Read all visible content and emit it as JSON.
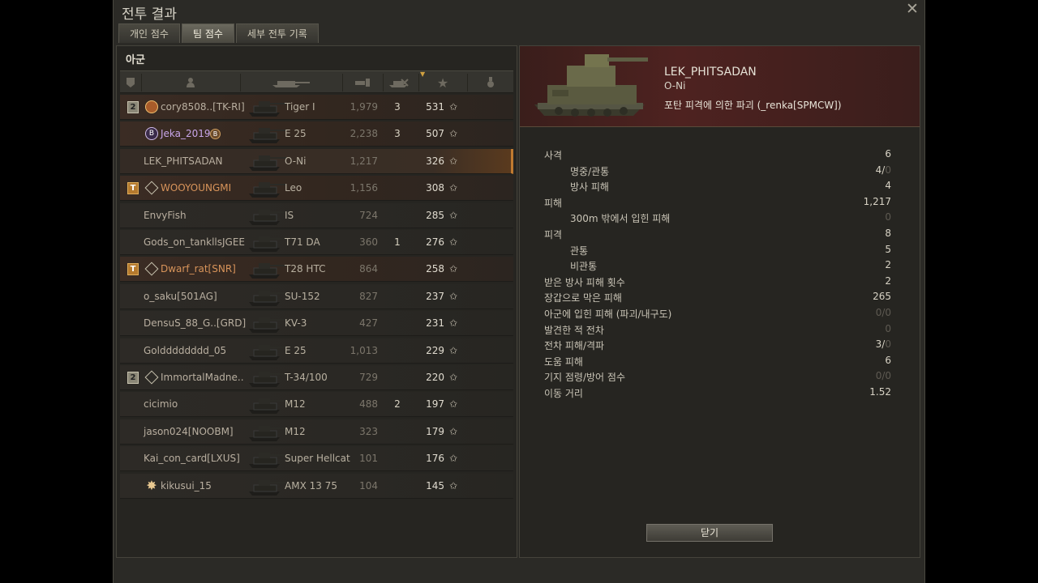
{
  "window": {
    "title": "전투 결과"
  },
  "tabs": [
    {
      "label": "개인 점수",
      "active": false
    },
    {
      "label": "팀 점수",
      "active": true
    },
    {
      "label": "세부 전투 기록",
      "active": false
    }
  ],
  "team": {
    "label": "아군"
  },
  "columns": [
    "platoon-icon",
    "player-icon",
    "tank-icon",
    "damage-icon",
    "kills-icon",
    "xp-star-icon",
    "medal-icon"
  ],
  "players": [
    {
      "badge": "2",
      "icon": "medal",
      "name": "cory8508..[TK-RI]",
      "tank": "Tiger I",
      "damage": "1,979",
      "kills": "3",
      "xp": "531",
      "dead": false
    },
    {
      "badge": "",
      "icon": "b-purple",
      "name": "Jeka_2019",
      "tank": "E 25",
      "damage": "2,238",
      "kills": "3",
      "xp": "507",
      "dead": false
    },
    {
      "badge": "",
      "icon": "",
      "name": "LEK_PHITSADAN",
      "tank": "O-Ni",
      "damage": "1,217",
      "kills": "",
      "xp": "326",
      "dead": true,
      "selected": true
    },
    {
      "badge": "T",
      "icon": "diamond",
      "name": "WOOYOUNGMI",
      "tank": "Leo",
      "damage": "1,156",
      "kills": "",
      "xp": "308",
      "dead": false
    },
    {
      "badge": "",
      "icon": "",
      "name": "EnvyFish",
      "tank": "IS",
      "damage": "724",
      "kills": "",
      "xp": "285",
      "dead": true
    },
    {
      "badge": "",
      "icon": "",
      "name": "Gods_on_tankllsJGEE",
      "tank": "T71 DA",
      "damage": "360",
      "kills": "1",
      "xp": "276",
      "dead": true
    },
    {
      "badge": "T",
      "icon": "diamond",
      "name": "Dwarf_rat[SNR]",
      "tank": "T28 HTC",
      "damage": "864",
      "kills": "",
      "xp": "258",
      "dead": false
    },
    {
      "badge": "",
      "icon": "",
      "name": "o_saku[501AG]",
      "tank": "SU-152",
      "damage": "827",
      "kills": "",
      "xp": "237",
      "dead": true
    },
    {
      "badge": "",
      "icon": "",
      "name": "DensuS_88_G..[GRD]",
      "tank": "KV-3",
      "damage": "427",
      "kills": "",
      "xp": "231",
      "dead": true
    },
    {
      "badge": "",
      "icon": "",
      "name": "Goldddddddd_05",
      "tank": "E 25",
      "damage": "1,013",
      "kills": "",
      "xp": "229",
      "dead": true
    },
    {
      "badge": "2",
      "icon": "diamond",
      "name": "ImmortalMadne..",
      "tank": "T-34/100",
      "damage": "729",
      "kills": "",
      "xp": "220",
      "dead": true
    },
    {
      "badge": "",
      "icon": "",
      "name": "cicimio",
      "tank": "M12",
      "damage": "488",
      "kills": "2",
      "xp": "197",
      "dead": true
    },
    {
      "badge": "",
      "icon": "",
      "name": "jason024[NOOBM]",
      "tank": "M12",
      "damage": "323",
      "kills": "",
      "xp": "179",
      "dead": true
    },
    {
      "badge": "",
      "icon": "",
      "name": "Kai_con_card[LXUS]",
      "tank": "Super Hellcat",
      "damage": "101",
      "kills": "",
      "xp": "176",
      "dead": true
    },
    {
      "badge": "",
      "icon": "star",
      "name": "kikusui_15",
      "tank": "AMX 13 75",
      "damage": "104",
      "kills": "",
      "xp": "145",
      "dead": true
    }
  ],
  "detail": {
    "player": "LEK_PHITSADAN",
    "tank": "O-Ni",
    "status": "포탄 피격에 의한 파괴 (_renka[SPMCW])",
    "stats": [
      {
        "label": "사격",
        "value": "6",
        "sub": false
      },
      {
        "label": "명중/관통",
        "value": "4/",
        "value2": "0",
        "sub": true
      },
      {
        "label": "방사 피해",
        "value": "4",
        "sub": true
      },
      {
        "label": "피해",
        "value": "1,217",
        "sub": false
      },
      {
        "label": "300m 밖에서 입힌 피해",
        "value": "0",
        "sub": true,
        "dim": true
      },
      {
        "label": "피격",
        "value": "8",
        "sub": false
      },
      {
        "label": "관통",
        "value": "5",
        "sub": true
      },
      {
        "label": "비관통",
        "value": "2",
        "sub": true
      },
      {
        "label": "받은 방사 피해 횟수",
        "value": "2",
        "sub": false
      },
      {
        "label": "장갑으로 막은 피해",
        "value": "265",
        "sub": false
      },
      {
        "label": "아군에 입힌 피해 (파괴/내구도)",
        "value": "0/0",
        "sub": false,
        "dim": true
      },
      {
        "label": "발견한 적 전차",
        "value": "0",
        "sub": false,
        "dim": true
      },
      {
        "label": "전차 피해/격파",
        "value": "3/",
        "value2": "0",
        "sub": false
      },
      {
        "label": "도움 피해",
        "value": "6",
        "sub": false
      },
      {
        "label": "기지 점령/방어 점수",
        "value": "0/0",
        "sub": false,
        "dim": true
      },
      {
        "label": "이동 거리",
        "value": "1.52",
        "sub": false
      }
    ],
    "close_label": "닫기"
  },
  "colors": {
    "selected_accent": "#c07a30",
    "alive_row": "#3b2c24",
    "purple_name": "#c7a5e8",
    "orange_name": "#d8945a"
  }
}
